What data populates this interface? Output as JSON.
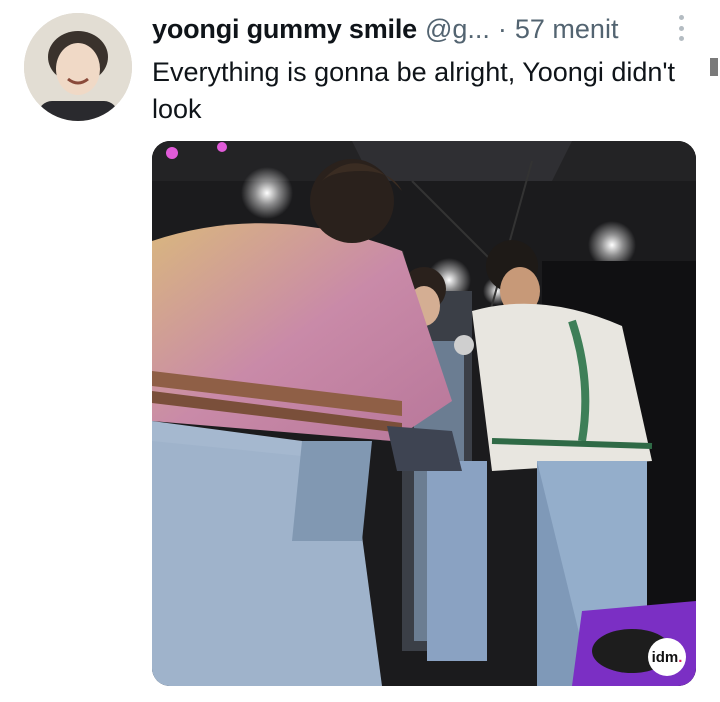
{
  "tweet": {
    "author": {
      "display_name": "yoongi gummy smile",
      "handle": "@g...",
      "separator": "·",
      "timestamp": "57 menit"
    },
    "text": "Everything is gonna be alright, Yoongi didn't look",
    "media": {
      "watermark_text": "idm",
      "watermark_dot": ".",
      "watermark_dot_color": "#e0245e"
    }
  },
  "icons": {
    "more": "vertical-ellipsis-icon"
  },
  "colors": {
    "text_primary": "#0f1419",
    "text_secondary": "#536471"
  }
}
